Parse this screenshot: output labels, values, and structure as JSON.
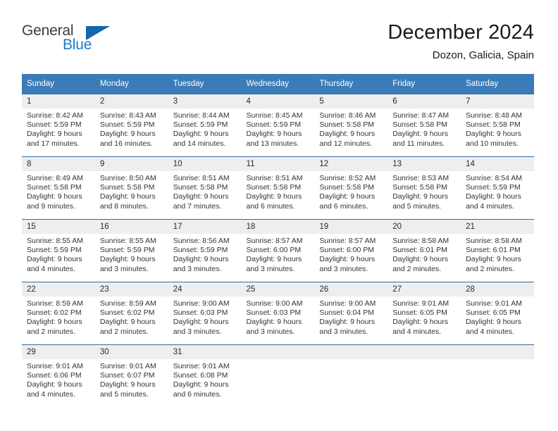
{
  "brand": {
    "name_part1": "General",
    "name_part2": "Blue",
    "accent_color": "#1566ab",
    "text_color": "#3c3c3c"
  },
  "header": {
    "title": "December 2024",
    "subtitle": "Dozon, Galicia, Spain"
  },
  "calendar": {
    "header_bg": "#3b7cb8",
    "row_divider": "#2f6ea5",
    "daynum_bg": "#eeeeee",
    "weekday_labels": [
      "Sunday",
      "Monday",
      "Tuesday",
      "Wednesday",
      "Thursday",
      "Friday",
      "Saturday"
    ],
    "weeks": [
      [
        {
          "day": "1",
          "sunrise": "Sunrise: 8:42 AM",
          "sunset": "Sunset: 5:59 PM",
          "daylight_line1": "Daylight: 9 hours",
          "daylight_line2": "and 17 minutes."
        },
        {
          "day": "2",
          "sunrise": "Sunrise: 8:43 AM",
          "sunset": "Sunset: 5:59 PM",
          "daylight_line1": "Daylight: 9 hours",
          "daylight_line2": "and 16 minutes."
        },
        {
          "day": "3",
          "sunrise": "Sunrise: 8:44 AM",
          "sunset": "Sunset: 5:59 PM",
          "daylight_line1": "Daylight: 9 hours",
          "daylight_line2": "and 14 minutes."
        },
        {
          "day": "4",
          "sunrise": "Sunrise: 8:45 AM",
          "sunset": "Sunset: 5:59 PM",
          "daylight_line1": "Daylight: 9 hours",
          "daylight_line2": "and 13 minutes."
        },
        {
          "day": "5",
          "sunrise": "Sunrise: 8:46 AM",
          "sunset": "Sunset: 5:58 PM",
          "daylight_line1": "Daylight: 9 hours",
          "daylight_line2": "and 12 minutes."
        },
        {
          "day": "6",
          "sunrise": "Sunrise: 8:47 AM",
          "sunset": "Sunset: 5:58 PM",
          "daylight_line1": "Daylight: 9 hours",
          "daylight_line2": "and 11 minutes."
        },
        {
          "day": "7",
          "sunrise": "Sunrise: 8:48 AM",
          "sunset": "Sunset: 5:58 PM",
          "daylight_line1": "Daylight: 9 hours",
          "daylight_line2": "and 10 minutes."
        }
      ],
      [
        {
          "day": "8",
          "sunrise": "Sunrise: 8:49 AM",
          "sunset": "Sunset: 5:58 PM",
          "daylight_line1": "Daylight: 9 hours",
          "daylight_line2": "and 9 minutes."
        },
        {
          "day": "9",
          "sunrise": "Sunrise: 8:50 AM",
          "sunset": "Sunset: 5:58 PM",
          "daylight_line1": "Daylight: 9 hours",
          "daylight_line2": "and 8 minutes."
        },
        {
          "day": "10",
          "sunrise": "Sunrise: 8:51 AM",
          "sunset": "Sunset: 5:58 PM",
          "daylight_line1": "Daylight: 9 hours",
          "daylight_line2": "and 7 minutes."
        },
        {
          "day": "11",
          "sunrise": "Sunrise: 8:51 AM",
          "sunset": "Sunset: 5:58 PM",
          "daylight_line1": "Daylight: 9 hours",
          "daylight_line2": "and 6 minutes."
        },
        {
          "day": "12",
          "sunrise": "Sunrise: 8:52 AM",
          "sunset": "Sunset: 5:58 PM",
          "daylight_line1": "Daylight: 9 hours",
          "daylight_line2": "and 6 minutes."
        },
        {
          "day": "13",
          "sunrise": "Sunrise: 8:53 AM",
          "sunset": "Sunset: 5:58 PM",
          "daylight_line1": "Daylight: 9 hours",
          "daylight_line2": "and 5 minutes."
        },
        {
          "day": "14",
          "sunrise": "Sunrise: 8:54 AM",
          "sunset": "Sunset: 5:59 PM",
          "daylight_line1": "Daylight: 9 hours",
          "daylight_line2": "and 4 minutes."
        }
      ],
      [
        {
          "day": "15",
          "sunrise": "Sunrise: 8:55 AM",
          "sunset": "Sunset: 5:59 PM",
          "daylight_line1": "Daylight: 9 hours",
          "daylight_line2": "and 4 minutes."
        },
        {
          "day": "16",
          "sunrise": "Sunrise: 8:55 AM",
          "sunset": "Sunset: 5:59 PM",
          "daylight_line1": "Daylight: 9 hours",
          "daylight_line2": "and 3 minutes."
        },
        {
          "day": "17",
          "sunrise": "Sunrise: 8:56 AM",
          "sunset": "Sunset: 5:59 PM",
          "daylight_line1": "Daylight: 9 hours",
          "daylight_line2": "and 3 minutes."
        },
        {
          "day": "18",
          "sunrise": "Sunrise: 8:57 AM",
          "sunset": "Sunset: 6:00 PM",
          "daylight_line1": "Daylight: 9 hours",
          "daylight_line2": "and 3 minutes."
        },
        {
          "day": "19",
          "sunrise": "Sunrise: 8:57 AM",
          "sunset": "Sunset: 6:00 PM",
          "daylight_line1": "Daylight: 9 hours",
          "daylight_line2": "and 3 minutes."
        },
        {
          "day": "20",
          "sunrise": "Sunrise: 8:58 AM",
          "sunset": "Sunset: 6:01 PM",
          "daylight_line1": "Daylight: 9 hours",
          "daylight_line2": "and 2 minutes."
        },
        {
          "day": "21",
          "sunrise": "Sunrise: 8:58 AM",
          "sunset": "Sunset: 6:01 PM",
          "daylight_line1": "Daylight: 9 hours",
          "daylight_line2": "and 2 minutes."
        }
      ],
      [
        {
          "day": "22",
          "sunrise": "Sunrise: 8:59 AM",
          "sunset": "Sunset: 6:02 PM",
          "daylight_line1": "Daylight: 9 hours",
          "daylight_line2": "and 2 minutes."
        },
        {
          "day": "23",
          "sunrise": "Sunrise: 8:59 AM",
          "sunset": "Sunset: 6:02 PM",
          "daylight_line1": "Daylight: 9 hours",
          "daylight_line2": "and 2 minutes."
        },
        {
          "day": "24",
          "sunrise": "Sunrise: 9:00 AM",
          "sunset": "Sunset: 6:03 PM",
          "daylight_line1": "Daylight: 9 hours",
          "daylight_line2": "and 3 minutes."
        },
        {
          "day": "25",
          "sunrise": "Sunrise: 9:00 AM",
          "sunset": "Sunset: 6:03 PM",
          "daylight_line1": "Daylight: 9 hours",
          "daylight_line2": "and 3 minutes."
        },
        {
          "day": "26",
          "sunrise": "Sunrise: 9:00 AM",
          "sunset": "Sunset: 6:04 PM",
          "daylight_line1": "Daylight: 9 hours",
          "daylight_line2": "and 3 minutes."
        },
        {
          "day": "27",
          "sunrise": "Sunrise: 9:01 AM",
          "sunset": "Sunset: 6:05 PM",
          "daylight_line1": "Daylight: 9 hours",
          "daylight_line2": "and 4 minutes."
        },
        {
          "day": "28",
          "sunrise": "Sunrise: 9:01 AM",
          "sunset": "Sunset: 6:05 PM",
          "daylight_line1": "Daylight: 9 hours",
          "daylight_line2": "and 4 minutes."
        }
      ],
      [
        {
          "day": "29",
          "sunrise": "Sunrise: 9:01 AM",
          "sunset": "Sunset: 6:06 PM",
          "daylight_line1": "Daylight: 9 hours",
          "daylight_line2": "and 4 minutes."
        },
        {
          "day": "30",
          "sunrise": "Sunrise: 9:01 AM",
          "sunset": "Sunset: 6:07 PM",
          "daylight_line1": "Daylight: 9 hours",
          "daylight_line2": "and 5 minutes."
        },
        {
          "day": "31",
          "sunrise": "Sunrise: 9:01 AM",
          "sunset": "Sunset: 6:08 PM",
          "daylight_line1": "Daylight: 9 hours",
          "daylight_line2": "and 6 minutes."
        },
        {
          "day": "",
          "sunrise": "",
          "sunset": "",
          "daylight_line1": "",
          "daylight_line2": ""
        },
        {
          "day": "",
          "sunrise": "",
          "sunset": "",
          "daylight_line1": "",
          "daylight_line2": ""
        },
        {
          "day": "",
          "sunrise": "",
          "sunset": "",
          "daylight_line1": "",
          "daylight_line2": ""
        },
        {
          "day": "",
          "sunrise": "",
          "sunset": "",
          "daylight_line1": "",
          "daylight_line2": ""
        }
      ]
    ]
  }
}
